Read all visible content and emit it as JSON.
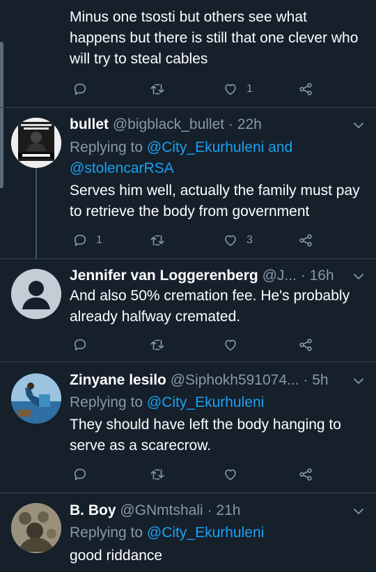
{
  "tweets": [
    {
      "text": "Minus one tsosti but others see what happens but there is still that one clever who will try to steal cables",
      "reply_count": "",
      "retweet_count": "",
      "like_count": "1"
    },
    {
      "name": "bullet",
      "handle": "@bigblack_bullet",
      "sep": "·",
      "time": "22h",
      "replying_prefix": "Replying to",
      "replying_to": "@City_Ekurhuleni",
      "replying_and": "and",
      "replying_to2": "@stolencarRSA",
      "text": "Serves him well, actually the family must pay to retrieve the body from government",
      "reply_count": "1",
      "retweet_count": "",
      "like_count": "3",
      "avatar_text": "WE'RE COULD NEVER MAKE AFRICA · ON STOLEN LAND"
    },
    {
      "name": "Jennifer van Loggerenberg",
      "handle": "@J...",
      "sep": "·",
      "time": "16h",
      "text": "And also 50% cremation fee. He's probably already halfway cremated.",
      "reply_count": "",
      "retweet_count": "",
      "like_count": ""
    },
    {
      "name": "Zinyane lesilo",
      "handle": "@Siphokh591074...",
      "sep": "·",
      "time": "5h",
      "replying_prefix": "Replying to",
      "replying_to": "@City_Ekurhuleni",
      "text": "They should have left the body hanging to serve as a scarecrow.",
      "reply_count": "",
      "retweet_count": "",
      "like_count": ""
    },
    {
      "name": "B. Boy",
      "handle": "@GNmtshali",
      "sep": "·",
      "time": "21h",
      "replying_prefix": "Replying to",
      "replying_to": "@City_Ekurhuleni",
      "text": "good riddance"
    }
  ],
  "colors": {
    "background": "#15202b",
    "text": "#ffffff",
    "muted": "#8899a6",
    "link": "#1da1f2",
    "divider": "#38444d"
  },
  "icons": {
    "reply": "reply-icon",
    "retweet": "retweet-icon",
    "like": "heart-icon",
    "share": "share-icon",
    "menu": "chevron-down-icon"
  }
}
